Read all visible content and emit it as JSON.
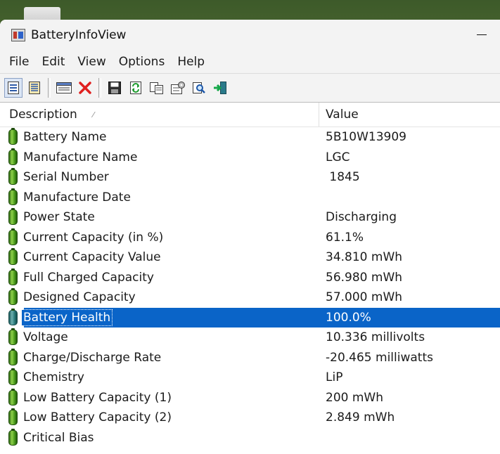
{
  "window": {
    "title": "BatteryInfoView"
  },
  "menu": [
    "File",
    "Edit",
    "View",
    "Options",
    "Help"
  ],
  "toolbar": {
    "buttons": [
      "view-mode-icon",
      "list-mode-icon",
      "html-report-icon",
      "delete-icon",
      "save-icon",
      "refresh-icon",
      "copy-icon",
      "properties-icon",
      "find-icon",
      "exit-icon"
    ]
  },
  "columns": {
    "description": "Description",
    "value": "Value"
  },
  "rows": [
    {
      "description": "Battery Name",
      "value": "5B10W13909"
    },
    {
      "description": "Manufacture Name",
      "value": "LGC"
    },
    {
      "description": "Serial Number",
      "value": " 1845"
    },
    {
      "description": "Manufacture Date",
      "value": ""
    },
    {
      "description": "Power State",
      "value": "Discharging"
    },
    {
      "description": "Current Capacity (in %)",
      "value": "61.1%"
    },
    {
      "description": "Current Capacity Value",
      "value": "34.810 mWh"
    },
    {
      "description": "Full Charged Capacity",
      "value": "56.980 mWh"
    },
    {
      "description": "Designed Capacity",
      "value": "57.000 mWh"
    },
    {
      "description": "Battery Health",
      "value": "100.0%",
      "selected": true
    },
    {
      "description": "Voltage",
      "value": "10.336 millivolts"
    },
    {
      "description": "Charge/Discharge Rate",
      "value": "-20.465 milliwatts"
    },
    {
      "description": "Chemistry",
      "value": "LiP"
    },
    {
      "description": "Low Battery Capacity (1)",
      "value": "200 mWh"
    },
    {
      "description": "Low Battery Capacity (2)",
      "value": "2.849 mWh"
    },
    {
      "description": "Critical Bias",
      "value": ""
    }
  ],
  "colors": {
    "selection": "#0a64c8",
    "battery": "#4a9a1c"
  }
}
